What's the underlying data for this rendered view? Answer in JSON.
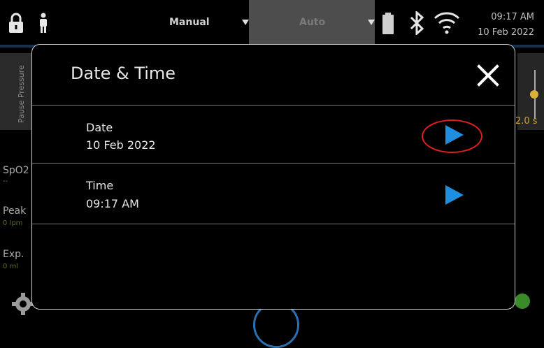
{
  "status_bar": {
    "mode_manual": "Manual",
    "mode_auto": "Auto",
    "time": "09:17 AM",
    "date": "10 Feb 2022",
    "icons": [
      "lock-icon",
      "person-icon",
      "battery-icon",
      "bluetooth-icon",
      "wifi-icon"
    ]
  },
  "background": {
    "pause_pressure_label": "Pause Pressure",
    "right_value": "2.0 s",
    "spo2_label": "SpO2",
    "spo2_value": "--",
    "peak_label": "Peak",
    "peak_unit": "0 lpm",
    "exp_label": "Exp.",
    "exp_unit": "0 ml"
  },
  "dialog": {
    "title": "Date & Time",
    "rows": [
      {
        "label": "Date",
        "value": "10 Feb 2022"
      },
      {
        "label": "Time",
        "value": "09:17 AM"
      }
    ]
  },
  "colors": {
    "accent": "#1e8fe0",
    "highlight_ring": "#e02020"
  }
}
